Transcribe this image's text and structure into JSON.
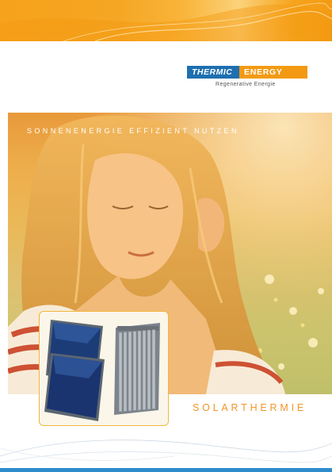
{
  "brand": {
    "name_part1": "THERMIC",
    "name_part2": "ENERGY",
    "tagline": "Regenerative Energie",
    "colors": {
      "blue": "#1e6fb0",
      "orange": "#f39a12"
    }
  },
  "cover": {
    "headline": "SONNENENERGIE EFFIZIENT NUTZEN",
    "product_title": "SOLARTHERMIE"
  },
  "images": {
    "hero": "woman-in-sunlit-meadow",
    "inset": "solar-panels-flat-and-vacuum-tube"
  },
  "accents": {
    "top_band": "#f5a623",
    "bottom_line": "#2e8ccc",
    "title": "#f0962a"
  }
}
